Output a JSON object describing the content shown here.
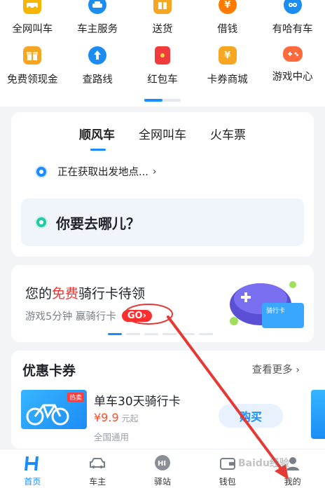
{
  "services": {
    "row1": [
      {
        "label": "全网叫车",
        "icon": "car-icon"
      },
      {
        "label": "车主服务",
        "icon": "car-owner-icon"
      },
      {
        "label": "送货",
        "icon": "package-icon"
      },
      {
        "label": "借钱",
        "icon": "yuan-coin-icon"
      },
      {
        "label": "有哈有车",
        "icon": "owl-icon"
      }
    ],
    "row2": [
      {
        "label": "免费领现金",
        "icon": "gift-icon"
      },
      {
        "label": "查路线",
        "icon": "route-icon"
      },
      {
        "label": "红包车",
        "icon": "red-envelope-icon"
      },
      {
        "label": "卡券商城",
        "icon": "ticket-icon"
      },
      {
        "label": "游戏中心",
        "icon": "gamepad-icon"
      }
    ]
  },
  "ride": {
    "tabs": [
      "顺风车",
      "全网叫车",
      "火车票"
    ],
    "active_tab": "顺风车",
    "pickup_text": "正在获取出发地点...",
    "destination_placeholder": "你要去哪儿？"
  },
  "promo": {
    "title_prefix": "您的",
    "title_highlight": "免费",
    "title_suffix": "骑行卡待领",
    "subtitle": "游戏5分钟 赢骑行卡",
    "go_label": "GO",
    "card_label": "骑行卡"
  },
  "coupons": {
    "heading": "优惠卡券",
    "more_label": "查看更多",
    "hot_tag": "热卖",
    "item_name": "单车30天骑行卡",
    "price": "¥9.9",
    "price_suffix": "元起",
    "scope": "全国通用",
    "buy_label": "购买"
  },
  "nav": {
    "items": [
      {
        "label": "首页",
        "icon": "hello-logo-icon",
        "active": true
      },
      {
        "label": "车主",
        "icon": "car-icon"
      },
      {
        "label": "驿站",
        "icon": "hi-bubble-icon"
      },
      {
        "label": "钱包",
        "icon": "wallet-icon"
      },
      {
        "label": "我的",
        "icon": "user-icon"
      }
    ]
  },
  "watermark": "Baidu经验",
  "colors": {
    "accent": "#1a8cff",
    "promo_red": "#ff2d2d",
    "price_orange": "#ff4d2d",
    "arrow_red": "#e53935"
  }
}
